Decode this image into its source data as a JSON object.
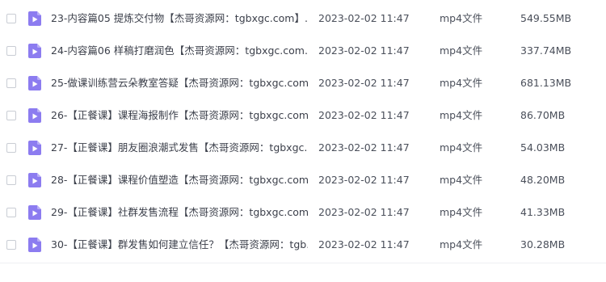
{
  "colors": {
    "icon_purple": "#8c7cf0",
    "checkbox_border": "#c9cdd4"
  },
  "files": [
    {
      "name": "23-内容篇05 提炼交付物【杰哥资源网：tgbxgc.com】....",
      "date": "2023-02-02 11:47",
      "type": "mp4文件",
      "size": "549.55MB",
      "icon": "video-file-icon"
    },
    {
      "name": "24-内容篇06 样稿打磨润色【杰哥资源网：tgbxgc.com...",
      "date": "2023-02-02 11:47",
      "type": "mp4文件",
      "size": "337.74MB",
      "icon": "video-file-icon"
    },
    {
      "name": "25-做课训练营云朵教室答疑【杰哥资源网：tgbxgc.com...",
      "date": "2023-02-02 11:47",
      "type": "mp4文件",
      "size": "681.13MB",
      "icon": "video-file-icon"
    },
    {
      "name": "26-【正餐课】课程海报制作【杰哥资源网：tgbxgc.com...",
      "date": "2023-02-02 11:47",
      "type": "mp4文件",
      "size": "86.70MB",
      "icon": "video-file-icon"
    },
    {
      "name": "27-【正餐课】朋友圈浪潮式发售【杰哥资源网：tgbxgc....",
      "date": "2023-02-02 11:47",
      "type": "mp4文件",
      "size": "54.03MB",
      "icon": "video-file-icon"
    },
    {
      "name": "28-【正餐课】课程价值塑造【杰哥资源网：tgbxgc.com...",
      "date": "2023-02-02 11:47",
      "type": "mp4文件",
      "size": "48.20MB",
      "icon": "video-file-icon"
    },
    {
      "name": "29-【正餐课】社群发售流程【杰哥资源网：tgbxgc.com...",
      "date": "2023-02-02 11:47",
      "type": "mp4文件",
      "size": "41.33MB",
      "icon": "video-file-icon"
    },
    {
      "name": "30-【正餐课】群发售如何建立信任？【杰哥资源网：tgb...",
      "date": "2023-02-02 11:47",
      "type": "mp4文件",
      "size": "30.28MB",
      "icon": "video-file-icon"
    }
  ]
}
